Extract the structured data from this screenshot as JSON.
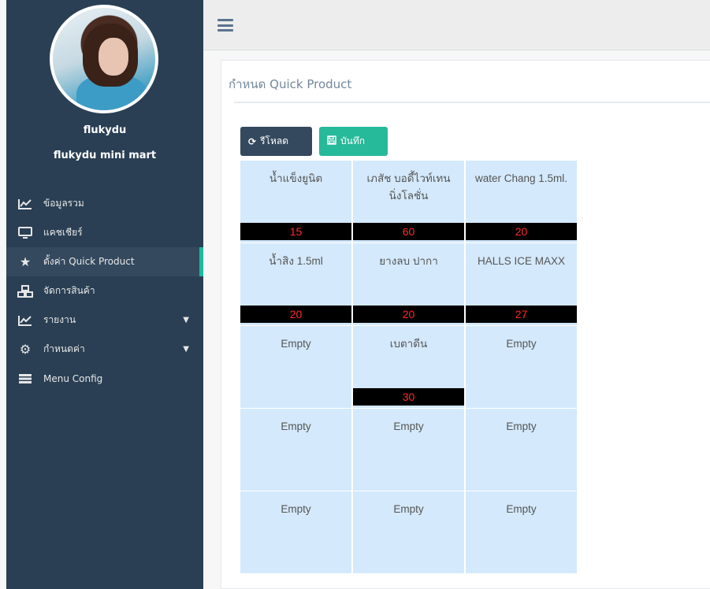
{
  "sidebar": {
    "user_name": "flukydu",
    "shop_name": "flukydu mini mart",
    "menu": [
      {
        "label": "ข้อมูลรวม",
        "icon": "line-chart-icon"
      },
      {
        "label": "แคชเชียร์",
        "icon": "desktop-icon"
      },
      {
        "label": "ตั้งค่า Quick Product",
        "icon": "star-icon"
      },
      {
        "label": "จัดการสินค้า",
        "icon": "cubes-icon"
      },
      {
        "label": "รายงาน",
        "icon": "line-chart-icon"
      },
      {
        "label": "กำหนดค่า",
        "icon": "cogs-icon"
      },
      {
        "label": "Menu Config",
        "icon": "server-icon"
      }
    ]
  },
  "panel": {
    "title": "กำหนด Quick Product",
    "reload_label": "รีโหลด",
    "save_label": "บันทึก"
  },
  "grid": [
    {
      "name": "น้ำแข็งยูนิต",
      "price": "15"
    },
    {
      "name": "เภสัช บอดี้ไวท์เทนนิ่งโลชั่น",
      "price": "60"
    },
    {
      "name": "water Chang 1.5ml.",
      "price": "20"
    },
    {
      "name": "น้ำสิง 1.5ml",
      "price": "20"
    },
    {
      "name": "ยางลบ ปากา",
      "price": "20"
    },
    {
      "name": "HALLS ICE MAXX",
      "price": "27"
    },
    {
      "name": "Empty",
      "price": ""
    },
    {
      "name": "เบตาดีน",
      "price": "30"
    },
    {
      "name": "Empty",
      "price": ""
    },
    {
      "name": "Empty",
      "price": ""
    },
    {
      "name": "Empty",
      "price": ""
    },
    {
      "name": "Empty",
      "price": ""
    },
    {
      "name": "Empty",
      "price": ""
    },
    {
      "name": "Empty",
      "price": ""
    },
    {
      "name": "Empty",
      "price": ""
    }
  ],
  "colors": {
    "sidebar_bg": "#2a3f54",
    "active_accent": "#1abb9c",
    "cell_bg": "#d4e9fb",
    "price_text": "#ff2a2a"
  }
}
